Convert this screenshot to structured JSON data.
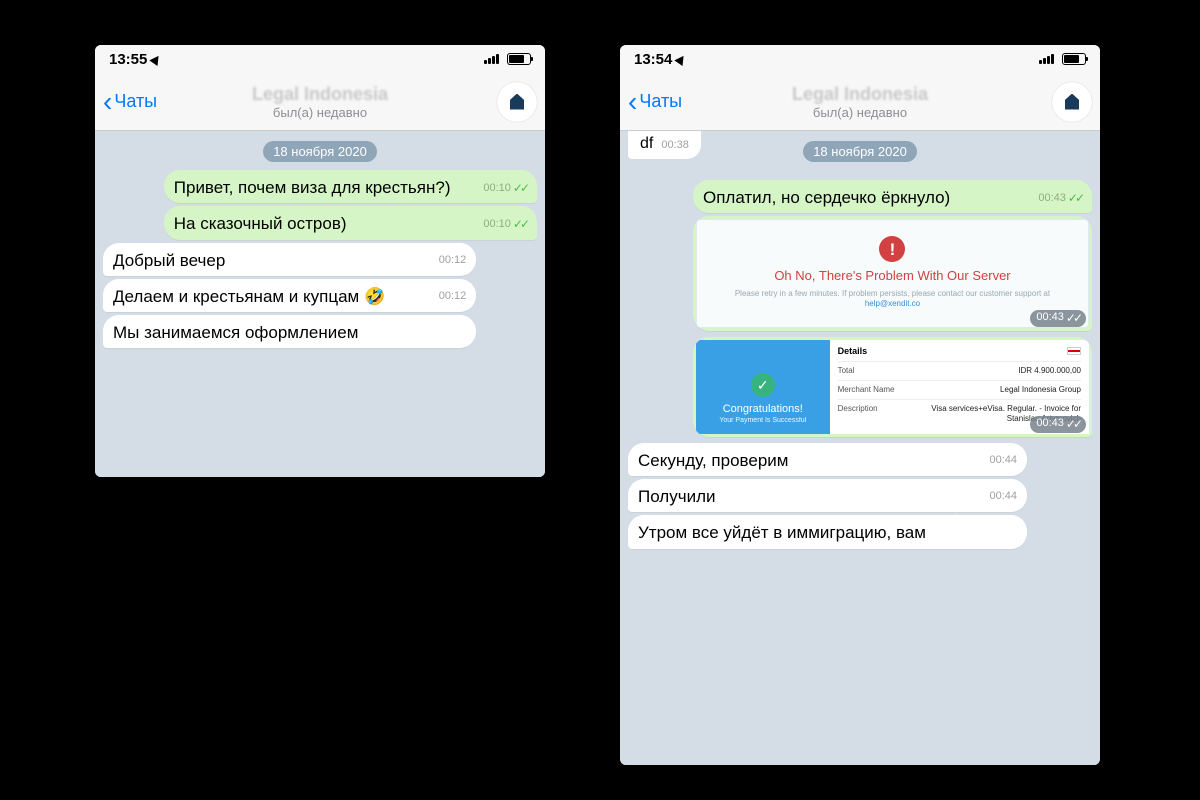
{
  "left": {
    "status_time": "13:55",
    "back_label": "Чаты",
    "chat_title": "Legal Indonesia",
    "chat_sub": "был(а) недавно",
    "date_pill": "18 ноября 2020",
    "m1": {
      "text": "Привет, почем виза для крестьян?)",
      "time": "00:10"
    },
    "m2": {
      "text": "На сказочный остров)",
      "time": "00:10"
    },
    "m3": {
      "text": "Добрый вечер",
      "time": "00:12"
    },
    "m4": {
      "text": "Делаем и крестьянам и купцам 🤣",
      "time": "00:12"
    },
    "m5": {
      "text": "Мы занимаемся оформлением"
    }
  },
  "right": {
    "status_time": "13:54",
    "back_label": "Чаты",
    "chat_title": "Legal Indonesia",
    "chat_sub": "был(а) недавно",
    "date_pill": "18 ноября 2020",
    "prev_fragment": {
      "text": "df",
      "time": "00:38"
    },
    "m1": {
      "text": "Оплатил, но сердечко ёркнуло)",
      "time": "00:43"
    },
    "err": {
      "title": "Oh No, There's Problem With Our Server",
      "sub_a": "Please retry in a few minutes. If problem persists, please contact our customer support at ",
      "sub_link": "help@xendit.co",
      "time": "00:43"
    },
    "succ": {
      "congr": "Congratulations!",
      "congr_sub": "Your Payment Is Successful",
      "details_h": "Details",
      "rows": {
        "total_k": "Total",
        "total_v": "IDR 4.900.000,00",
        "merch_k": "Merchant Name",
        "merch_v": "Legal Indonesia Group",
        "desc_k": "Description",
        "desc_v": "Visa services+eVisa. Regular. - Invoice for Stanislau Artymovich"
      },
      "time": "00:43"
    },
    "m2": {
      "text": "Секунду, проверим",
      "time": "00:44"
    },
    "m3": {
      "text": "Получили",
      "time": "00:44"
    },
    "m4": {
      "text": "Утром все уйдёт в иммиграцию, вам"
    }
  }
}
